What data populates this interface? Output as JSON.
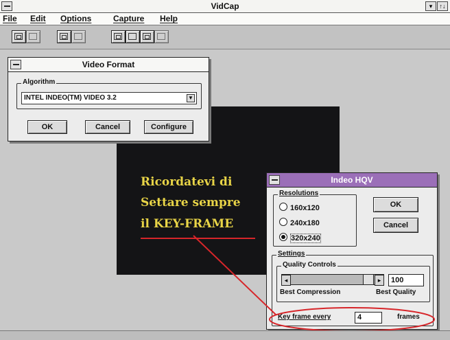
{
  "app": {
    "title": "VidCap",
    "menu": [
      "File",
      "Edit",
      "Options",
      "Capture",
      "Help"
    ],
    "scroll_glyph": "↑↓",
    "control_glyph": "▾"
  },
  "video_format": {
    "title": "Video Format",
    "algorithm_label": "Algorithm",
    "algorithm_value": "INTEL INDEO(TM) VIDEO 3.2",
    "ok": "OK",
    "cancel": "Cancel",
    "configure": "Configure"
  },
  "preview": {
    "lines": [
      "Ricordatevi di",
      "Settare sempre",
      "il KEY-FRAME"
    ],
    "text_color": "#e8d447",
    "annotation_color": "#d7262a"
  },
  "indeo": {
    "title": "Indeo HQV",
    "title_color": "#9b6fb8",
    "resolutions_label": "Resolutions",
    "resolutions": [
      "160x120",
      "240x180",
      "320x240"
    ],
    "selected_resolution": "320x240",
    "ok": "OK",
    "cancel": "Cancel",
    "settings_label": "Settings",
    "quality_label": "Quality Controls",
    "quality_value": "100",
    "best_compression": "Best Compression",
    "best_quality": "Best Quality",
    "keyframe_label": "Key frame every",
    "keyframe_value": "4",
    "frames_label": "frames"
  }
}
